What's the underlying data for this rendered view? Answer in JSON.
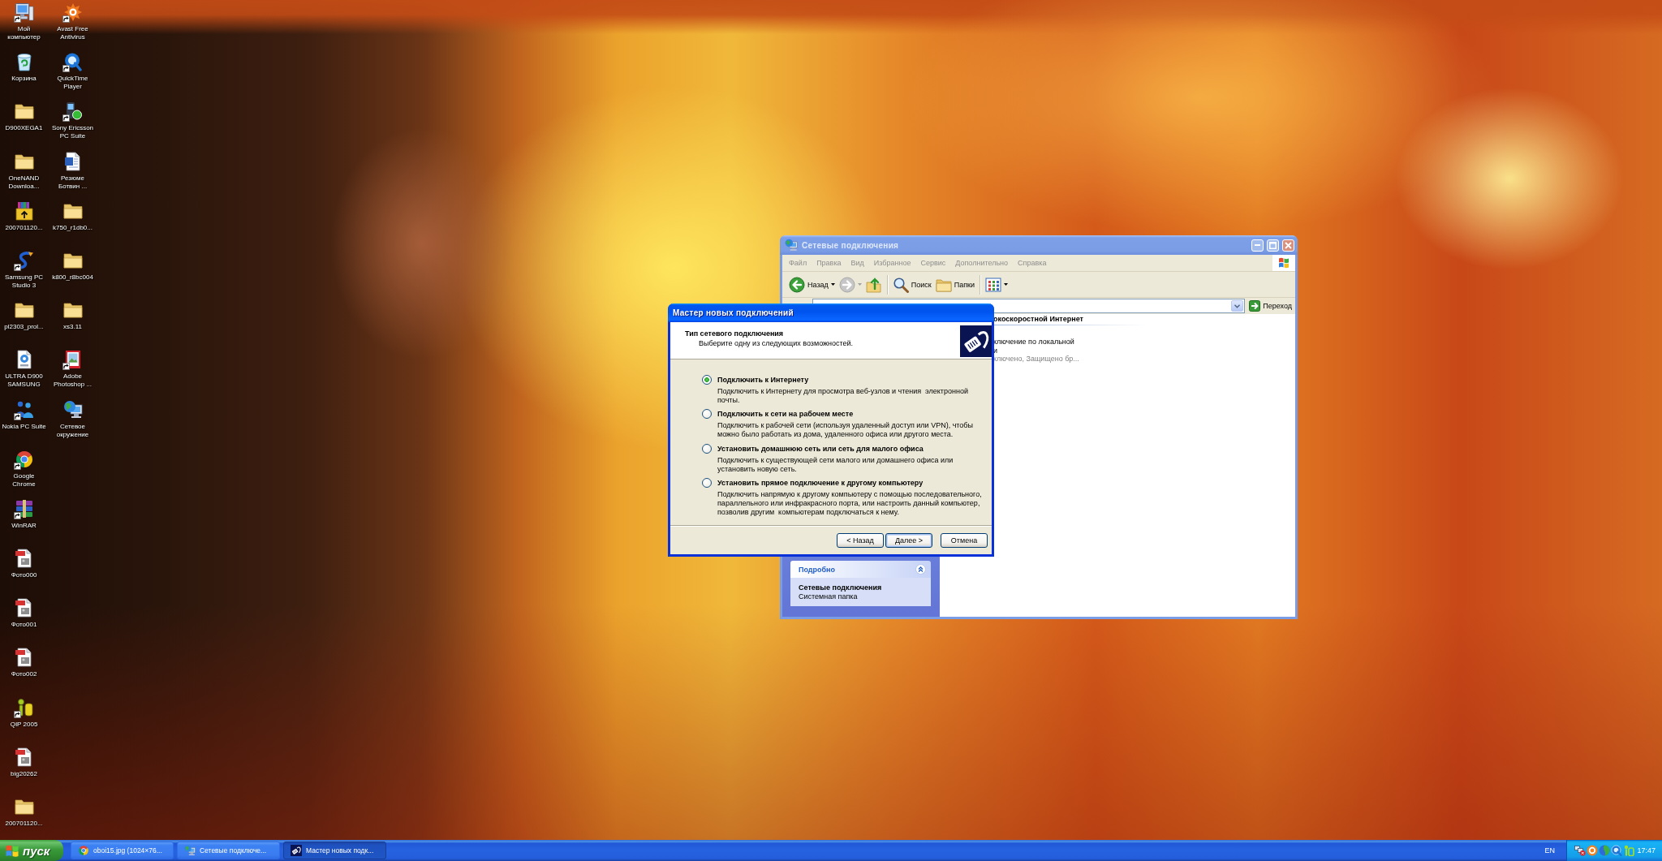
{
  "desktop": {
    "icon_columns": [
      {
        "icons": [
          {
            "label": "Мой\nкомпьютер",
            "kind": "computer",
            "shortcut": true
          },
          {
            "label": "Корзина",
            "kind": "recycle-bin",
            "shortcut": false
          },
          {
            "label": "D900XEGA1",
            "kind": "folder",
            "shortcut": false
          },
          {
            "label": "OneNAND\nDownloa...",
            "kind": "folder",
            "shortcut": false
          },
          {
            "label": "200701120...",
            "kind": "installer",
            "shortcut": false
          },
          {
            "label": "Samsung PC\nStudio 3",
            "kind": "swirl",
            "shortcut": true
          },
          {
            "label": "pl2303_prol...",
            "kind": "folder",
            "shortcut": false
          },
          {
            "label": "ULTRA D900\nSAMSUNG",
            "kind": "media-file",
            "shortcut": false
          },
          {
            "label": "Nokia PC Suite",
            "kind": "people",
            "shortcut": true
          },
          {
            "label": "Google\nChrome",
            "kind": "browser",
            "shortcut": true
          },
          {
            "label": "WinRAR",
            "kind": "books",
            "shortcut": true
          },
          {
            "label": "Фото000",
            "kind": "image-file",
            "shortcut": false
          },
          {
            "label": "Фото001",
            "kind": "image-file",
            "shortcut": false
          },
          {
            "label": "Фото002",
            "kind": "image-file",
            "shortcut": false
          },
          {
            "label": "QIP 2005",
            "kind": "figure",
            "shortcut": true
          },
          {
            "label": "big20262",
            "kind": "image-file",
            "shortcut": false
          },
          {
            "label": "200701120...",
            "kind": "folder",
            "shortcut": false
          }
        ]
      },
      {
        "icons": [
          {
            "label": "Avast Free\nAntivirus",
            "kind": "splat",
            "shortcut": true
          },
          {
            "label": "QuickTime\nPlayer",
            "kind": "q-logo",
            "shortcut": true
          },
          {
            "label": "Sony Ericsson\nPC Suite",
            "kind": "phone",
            "shortcut": true
          },
          {
            "label": "Резюме\nБотвин ...",
            "kind": "document",
            "shortcut": false
          },
          {
            "label": "k750_r1db0...",
            "kind": "folder",
            "shortcut": false
          },
          {
            "label": "k800_r8bc004",
            "kind": "folder",
            "shortcut": false
          },
          {
            "label": "xs3.11",
            "kind": "folder",
            "shortcut": false
          },
          {
            "label": "Adobe\nPhotoshop ...",
            "kind": "picture-frame",
            "shortcut": true
          },
          {
            "label": "Сетевое\nокружение",
            "kind": "network-globe",
            "shortcut": false
          }
        ]
      }
    ]
  },
  "explorer_window": {
    "title": "Сетевые подключения",
    "active": false,
    "menu": [
      "Файл",
      "Правка",
      "Вид",
      "Избранное",
      "Сервис",
      "Дополнительно",
      "Справка"
    ],
    "toolbar": [
      {
        "kind": "back",
        "label": "Назад",
        "disabled": false
      },
      {
        "kind": "forward",
        "disabled": true
      },
      {
        "kind": "up",
        "disabled": false
      },
      {
        "kind": "separator"
      },
      {
        "kind": "search",
        "label": "Поиск",
        "disabled": false
      },
      {
        "kind": "folders",
        "label": "Папки",
        "disabled": false
      },
      {
        "kind": "separator"
      },
      {
        "kind": "views",
        "disabled": false
      }
    ],
    "address_bar": {
      "go_button": "Переход"
    },
    "task_pane": {
      "title": "Подробно",
      "expanded": true,
      "details_title": "Сетевые подключения",
      "details_subtitle": "Системная папка"
    },
    "content": {
      "group_header": "окоскоростной Интернет",
      "items": [
        {
          "name": "ключение по локальной\nи",
          "status": "ключено, Защищено бр..."
        }
      ]
    }
  },
  "wizard_dialog": {
    "title": "Мастер новых подключений",
    "active": true,
    "header": {
      "title": "Тип сетевого подключения",
      "subtitle": "Выберите одну из следующих возможностей."
    },
    "options": [
      {
        "label": "Подключить к Интернету",
        "description": "Подключить к Интернету для просмотра веб-узлов и чтения  электронной\nпочты.",
        "selected": true
      },
      {
        "label": "Подключить к сети на рабочем месте",
        "description": "Подключить к рабочей сети (используя удаленный доступ или VPN), чтобы\nможно было работать из дома, удаленного офиса или другого места.",
        "selected": false
      },
      {
        "label": "Установить домашнюю сеть или сеть для малого офиса",
        "description": "Подключить к существующей сети малого или домашнего офиса или\nустановить новую сеть.",
        "selected": false
      },
      {
        "label": "Установить прямое подключение к другому компьютеру",
        "description": "Подключить напрямую к другому компьютеру с помощью последовательного,\nпараллельного или инфракрасного порта, или настроить данный компьютер,\nпозволив другим  компьютерам подключаться к нему.",
        "selected": false
      }
    ],
    "buttons": [
      {
        "label": "< Назад",
        "default": false
      },
      {
        "label": "Далее >",
        "default": true
      },
      {
        "label": "Отмена",
        "default": false
      }
    ]
  },
  "taskbar": {
    "start_button": "пуск",
    "tasks": [
      {
        "label": "oboi15.jpg (1024×76...",
        "kind": "browser",
        "selected": false
      },
      {
        "label": "Сетевые подключе...",
        "kind": "network-globe",
        "selected": false
      },
      {
        "label": "Мастер новых подк...",
        "kind": "wizard",
        "selected": true
      }
    ],
    "language": "EN",
    "clock": "17:47"
  }
}
